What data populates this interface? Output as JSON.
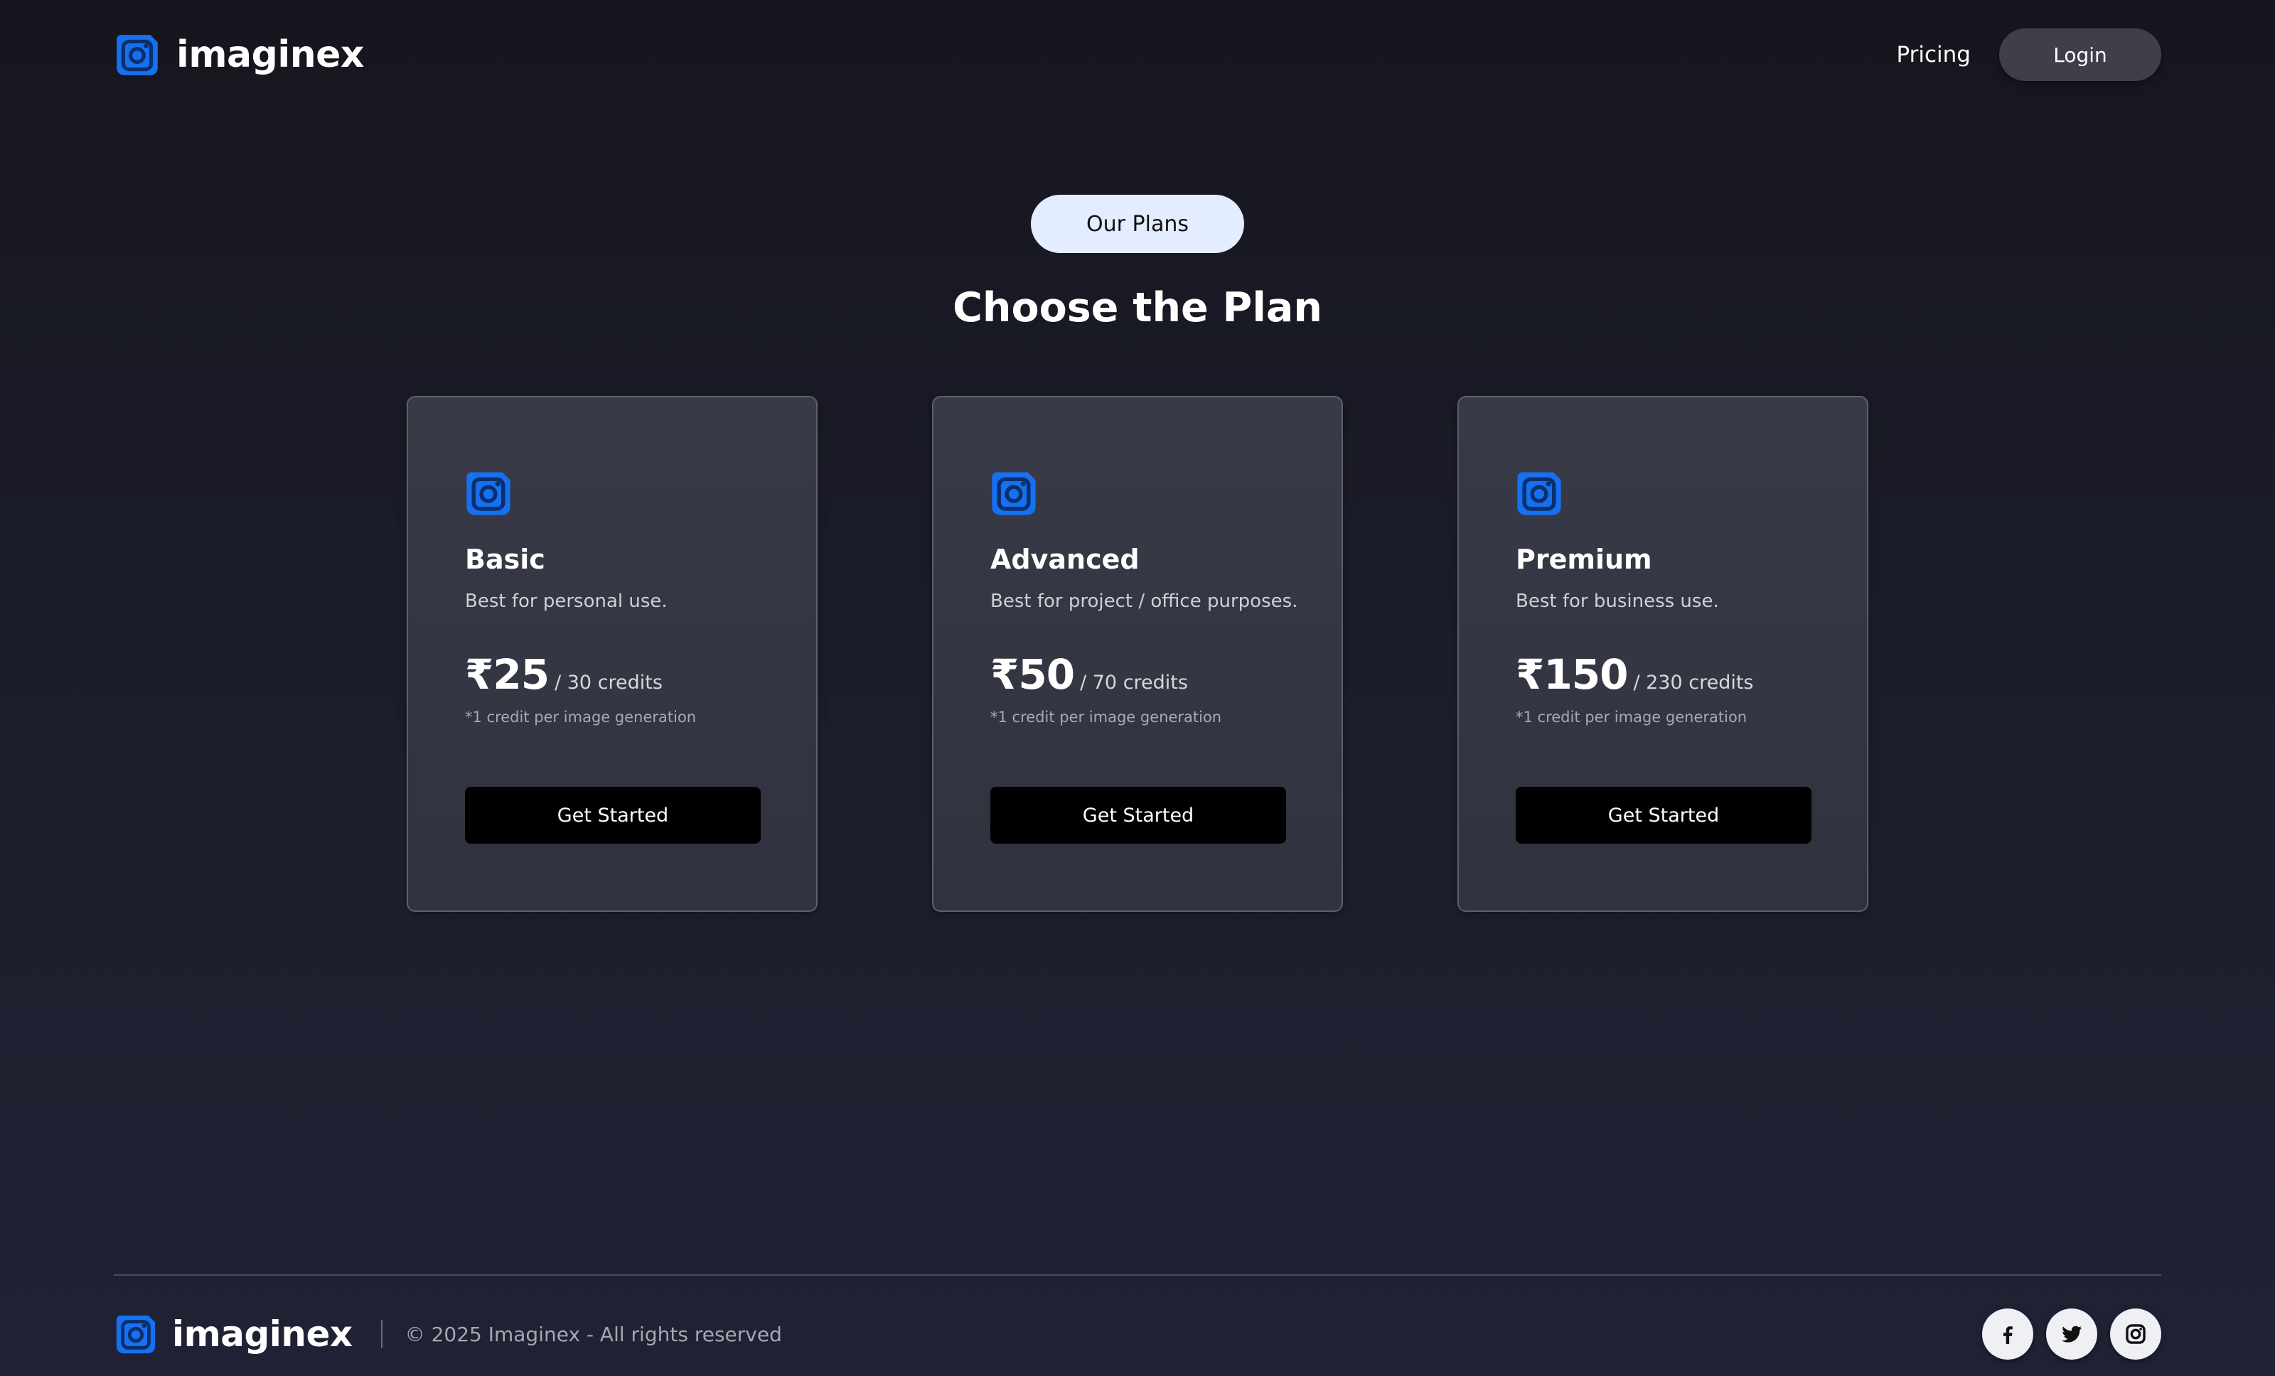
{
  "header": {
    "brand": "imaginex",
    "nav_link": "Pricing",
    "login_label": "Login"
  },
  "hero": {
    "badge": "Our Plans",
    "title": "Choose the Plan"
  },
  "plans": [
    {
      "name": "Basic",
      "description": "Best for personal use.",
      "price": "₹25",
      "credits": "/ 30 credits",
      "note": "*1 credit per image generation",
      "cta": "Get Started"
    },
    {
      "name": "Advanced",
      "description": "Best for project / office purposes.",
      "price": "₹50",
      "credits": "/ 70 credits",
      "note": "*1 credit per image generation",
      "cta": "Get Started"
    },
    {
      "name": "Premium",
      "description": "Best for business use.",
      "price": "₹150",
      "credits": "/ 230 credits",
      "note": "*1 credit per image generation",
      "cta": "Get Started"
    }
  ],
  "footer": {
    "brand": "imaginex",
    "copyright": "© 2025 Imaginex - All rights reserved",
    "socials": [
      "facebook-icon",
      "twitter-icon",
      "instagram-icon"
    ]
  },
  "colors": {
    "accent": "#1670f0",
    "background": "#1c1e2c",
    "card": "#363845",
    "badge": "#e3edff"
  }
}
